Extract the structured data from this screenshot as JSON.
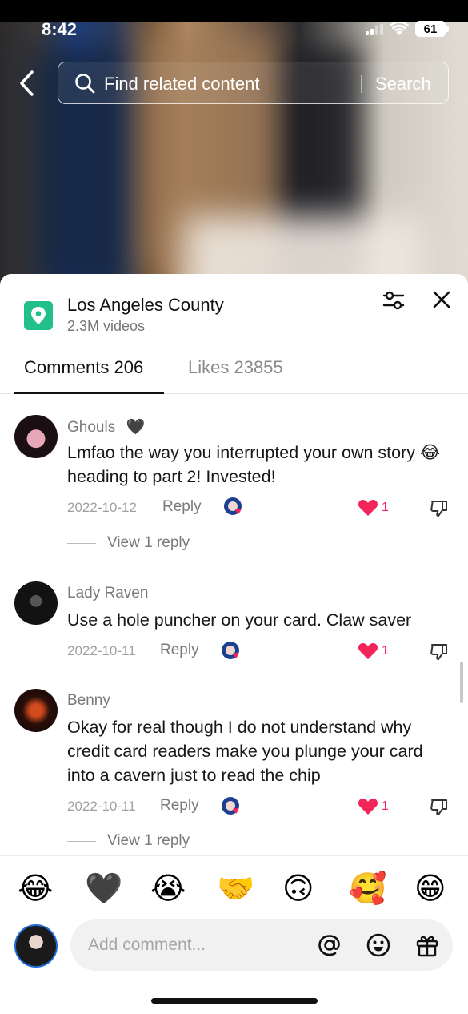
{
  "status": {
    "time": "8:42",
    "battery": "61"
  },
  "search": {
    "placeholder": "Find related content",
    "button": "Search"
  },
  "location": {
    "name": "Los Angeles County",
    "video_count": "2.3M videos"
  },
  "tabs": {
    "comments": "Comments 206",
    "likes": "Likes 23855"
  },
  "comments": [
    {
      "user": "Ghouls",
      "user_badge": "🖤",
      "text": "Lmfao the way you interrupted your own story 😂 heading to part 2! Invested!",
      "date": "2022-10-12",
      "reply_label": "Reply",
      "likes": "1",
      "view_replies": "View 1 reply"
    },
    {
      "user": "Lady Raven",
      "text": "Use a hole puncher on your card. Claw saver",
      "date": "2022-10-11",
      "reply_label": "Reply",
      "likes": "1"
    },
    {
      "user": "Benny",
      "text": "Okay for real though I do not understand why credit card readers make you plunge your card into a cavern just to read the chip",
      "date": "2022-10-11",
      "reply_label": "Reply",
      "likes": "1",
      "view_replies": "View 1 reply"
    }
  ],
  "emojis": [
    "😂",
    "🖤",
    "😭",
    "🤝",
    "🙃",
    "🥰",
    "😁"
  ],
  "composer": {
    "placeholder": "Add comment..."
  },
  "colors": {
    "accent_like": "#f2245a",
    "location_pin": "#20c088"
  },
  "icons": [
    "back-arrow-icon",
    "search-icon",
    "filter-icon",
    "close-icon",
    "location-pin-icon",
    "heart-icon",
    "dislike-icon",
    "at-icon",
    "emoji-face-icon",
    "gift-icon"
  ]
}
